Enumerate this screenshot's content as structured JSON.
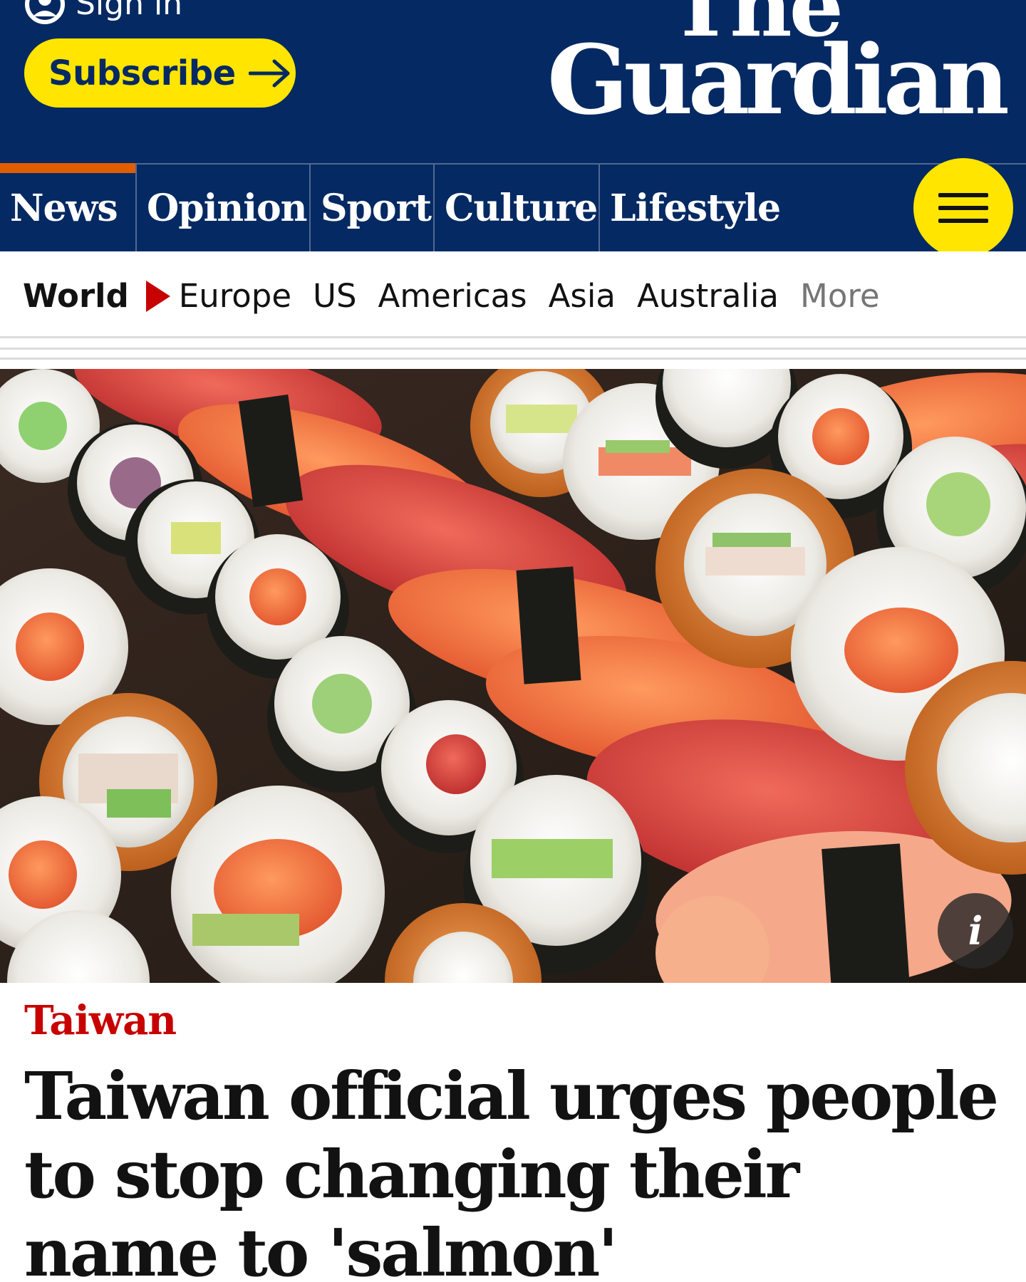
{
  "header": {
    "signin_label": "Sign in",
    "subscribe_label": "Subscribe",
    "logo_line1": "The",
    "logo_line2": "Guardian"
  },
  "nav": {
    "items": [
      {
        "label": "News"
      },
      {
        "label": "Opinion"
      },
      {
        "label": "Sport"
      },
      {
        "label": "Culture"
      },
      {
        "label": "Lifestyle"
      }
    ],
    "menu_icon": "hamburger-icon"
  },
  "subnav": {
    "section": "World",
    "links": [
      "Europe",
      "US",
      "Americas",
      "Asia",
      "Australia"
    ],
    "more": "More"
  },
  "hero": {
    "info_glyph": "i"
  },
  "article": {
    "kicker": "Taiwan",
    "headline": "Taiwan official urges people to stop changing their name to 'salmon'"
  },
  "colors": {
    "brand_blue": "#052962",
    "subscribe_yellow": "#ffe500",
    "kicker_red": "#c70000",
    "news_underline": "#e05e00"
  }
}
